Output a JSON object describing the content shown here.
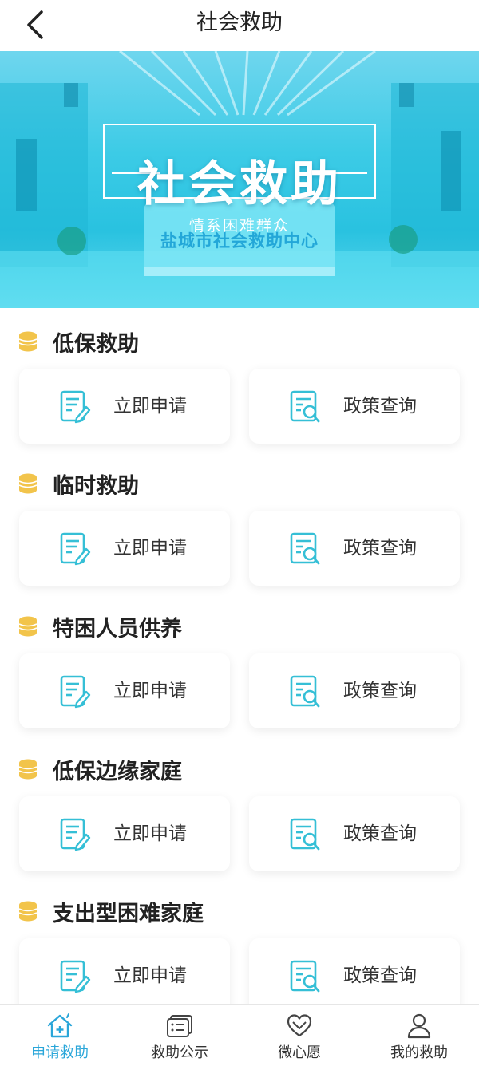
{
  "header": {
    "title": "社会救助"
  },
  "banner": {
    "title": "社会救助",
    "subtitle": "情系困难群众",
    "desk_label": "盐城市社会救助中心"
  },
  "sections": [
    {
      "title": "低保救助",
      "apply_label": "立即申请",
      "policy_label": "政策查询"
    },
    {
      "title": "临时救助",
      "apply_label": "立即申请",
      "policy_label": "政策查询"
    },
    {
      "title": "特困人员供养",
      "apply_label": "立即申请",
      "policy_label": "政策查询"
    },
    {
      "title": "低保边缘家庭",
      "apply_label": "立即申请",
      "policy_label": "政策查询"
    },
    {
      "title": "支出型困难家庭",
      "apply_label": "立即申请",
      "policy_label": "政策查询"
    }
  ],
  "tabbar": {
    "items": [
      {
        "label": "申请救助",
        "icon": "home-plus-icon",
        "active": true
      },
      {
        "label": "救助公示",
        "icon": "notice-board-icon",
        "active": false
      },
      {
        "label": "微心愿",
        "icon": "heart-icon",
        "active": false
      },
      {
        "label": "我的救助",
        "icon": "user-icon",
        "active": false
      }
    ]
  },
  "colors": {
    "accent": "#2aa6d9",
    "icon_teal": "#35bfd6",
    "coin": "#f2c44b",
    "banner": "#3ccbe6"
  }
}
